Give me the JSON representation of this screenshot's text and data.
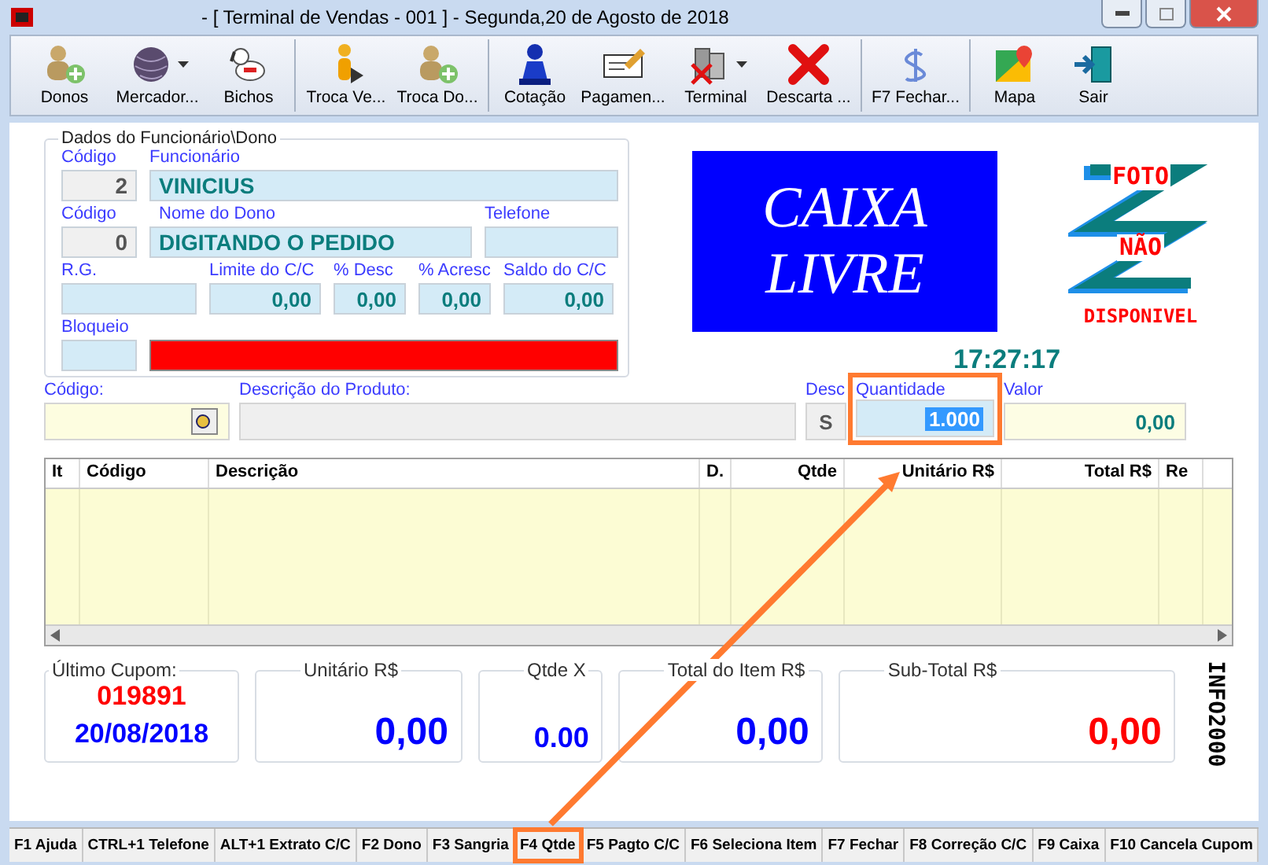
{
  "window": {
    "title": "- [ Terminal de Vendas - 001 ] - Segunda,20 de Agosto de 2018"
  },
  "toolbar": [
    [
      {
        "label": "Donos",
        "dropdown": false
      },
      {
        "label": "Mercador...",
        "dropdown": true
      },
      {
        "label": "Bichos",
        "dropdown": false
      }
    ],
    [
      {
        "label": "Troca Ve...",
        "dropdown": false
      },
      {
        "label": "Troca Do...",
        "dropdown": false
      }
    ],
    [
      {
        "label": "Cotação",
        "dropdown": false
      },
      {
        "label": "Pagamen...",
        "dropdown": false
      },
      {
        "label": "Terminal",
        "dropdown": true
      },
      {
        "label": "Descarta ...",
        "dropdown": false
      }
    ],
    [
      {
        "label": "F7 Fechar...",
        "dropdown": false
      }
    ],
    [
      {
        "label": "Mapa",
        "dropdown": false
      },
      {
        "label": "Sair",
        "dropdown": false
      }
    ]
  ],
  "employee": {
    "title": "Dados do Funcionário\\Dono",
    "rows": [
      {
        "fields": [
          {
            "label": "Código",
            "value": "2",
            "kind": "code"
          },
          {
            "label": "Funcionário",
            "value": "VINICIUS",
            "kind": "text"
          }
        ]
      },
      {
        "fields": [
          {
            "label": "Código",
            "value": "0",
            "kind": "code"
          },
          {
            "label": "Nome do Dono",
            "value": "DIGITANDO O PEDIDO",
            "kind": "text"
          },
          {
            "label": "Telefone",
            "kind": "text"
          }
        ]
      },
      {
        "fields": [
          {
            "label": "R.G.",
            "kind": "text"
          },
          {
            "label": "Limite do C/C",
            "value": "0,00",
            "kind": "number"
          },
          {
            "label": "% Desc",
            "value": "0,00",
            "kind": "number"
          },
          {
            "label": "% Acresc",
            "value": "0,00",
            "kind": "number"
          },
          {
            "label": "Saldo do C/C",
            "value": "0,00",
            "kind": "number"
          }
        ]
      },
      {
        "fields": [
          {
            "label": "Bloqueio",
            "kind": "text"
          },
          {
            "kind": "alert"
          }
        ]
      }
    ]
  },
  "status": {
    "lines": [
      "CAIXA",
      "LIVRE"
    ]
  },
  "photo": {
    "lines": [
      "FOTO",
      "NÃO",
      "DISPONIVEL"
    ]
  },
  "clock": "17:27:17",
  "product": [
    {
      "label": "Código:",
      "kind": "search"
    },
    {
      "label": "Descrição do  Produto:",
      "kind": "readonly"
    },
    {
      "label": "Desc",
      "value": "S",
      "kind": "flag"
    },
    {
      "label": "Quantidade",
      "value": "1.000",
      "kind": "selected",
      "marked": true
    },
    {
      "label": "Valor",
      "value": "0,00",
      "kind": "number"
    }
  ],
  "table": {
    "columns": [
      "It",
      "Código",
      "Descrição",
      "D.",
      "Qtde",
      "Unitário R$",
      "Total R$",
      "Re"
    ]
  },
  "last_coupon": {
    "label": "Último Cupom:",
    "number": "019891",
    "date": "20/08/2018"
  },
  "totals": [
    {
      "label": "Unitário R$",
      "value": "0,00",
      "color": "#0000ff"
    },
    {
      "label": "Qtde X",
      "value": "0.00",
      "color": "#0000ff"
    },
    {
      "label": "Total do Item R$",
      "value": "0,00",
      "color": "#0000ff"
    },
    {
      "label": "Sub-Total R$",
      "value": "0,00",
      "color": "#ff0000"
    }
  ],
  "logo": {
    "text": "INFO2000"
  },
  "function_keys": [
    {
      "label": "F1 Ajuda",
      "marked": false
    },
    {
      "label": "CTRL+1 Telefone",
      "marked": false
    },
    {
      "label": "ALT+1 Extrato C/C",
      "marked": false
    },
    {
      "label": "F2 Dono",
      "marked": false
    },
    {
      "label": "F3 Sangria",
      "marked": false
    },
    {
      "label": "F4 Qtde",
      "marked": true
    },
    {
      "label": "F5 Pagto C/C",
      "marked": false
    },
    {
      "label": "F6 Seleciona Item",
      "marked": false
    },
    {
      "label": "F7 Fechar",
      "marked": false
    },
    {
      "label": "F8 Correção C/C",
      "marked": false
    },
    {
      "label": "F9 Caixa",
      "marked": false
    },
    {
      "label": "F10 Cancela Cupom",
      "marked": false
    }
  ]
}
